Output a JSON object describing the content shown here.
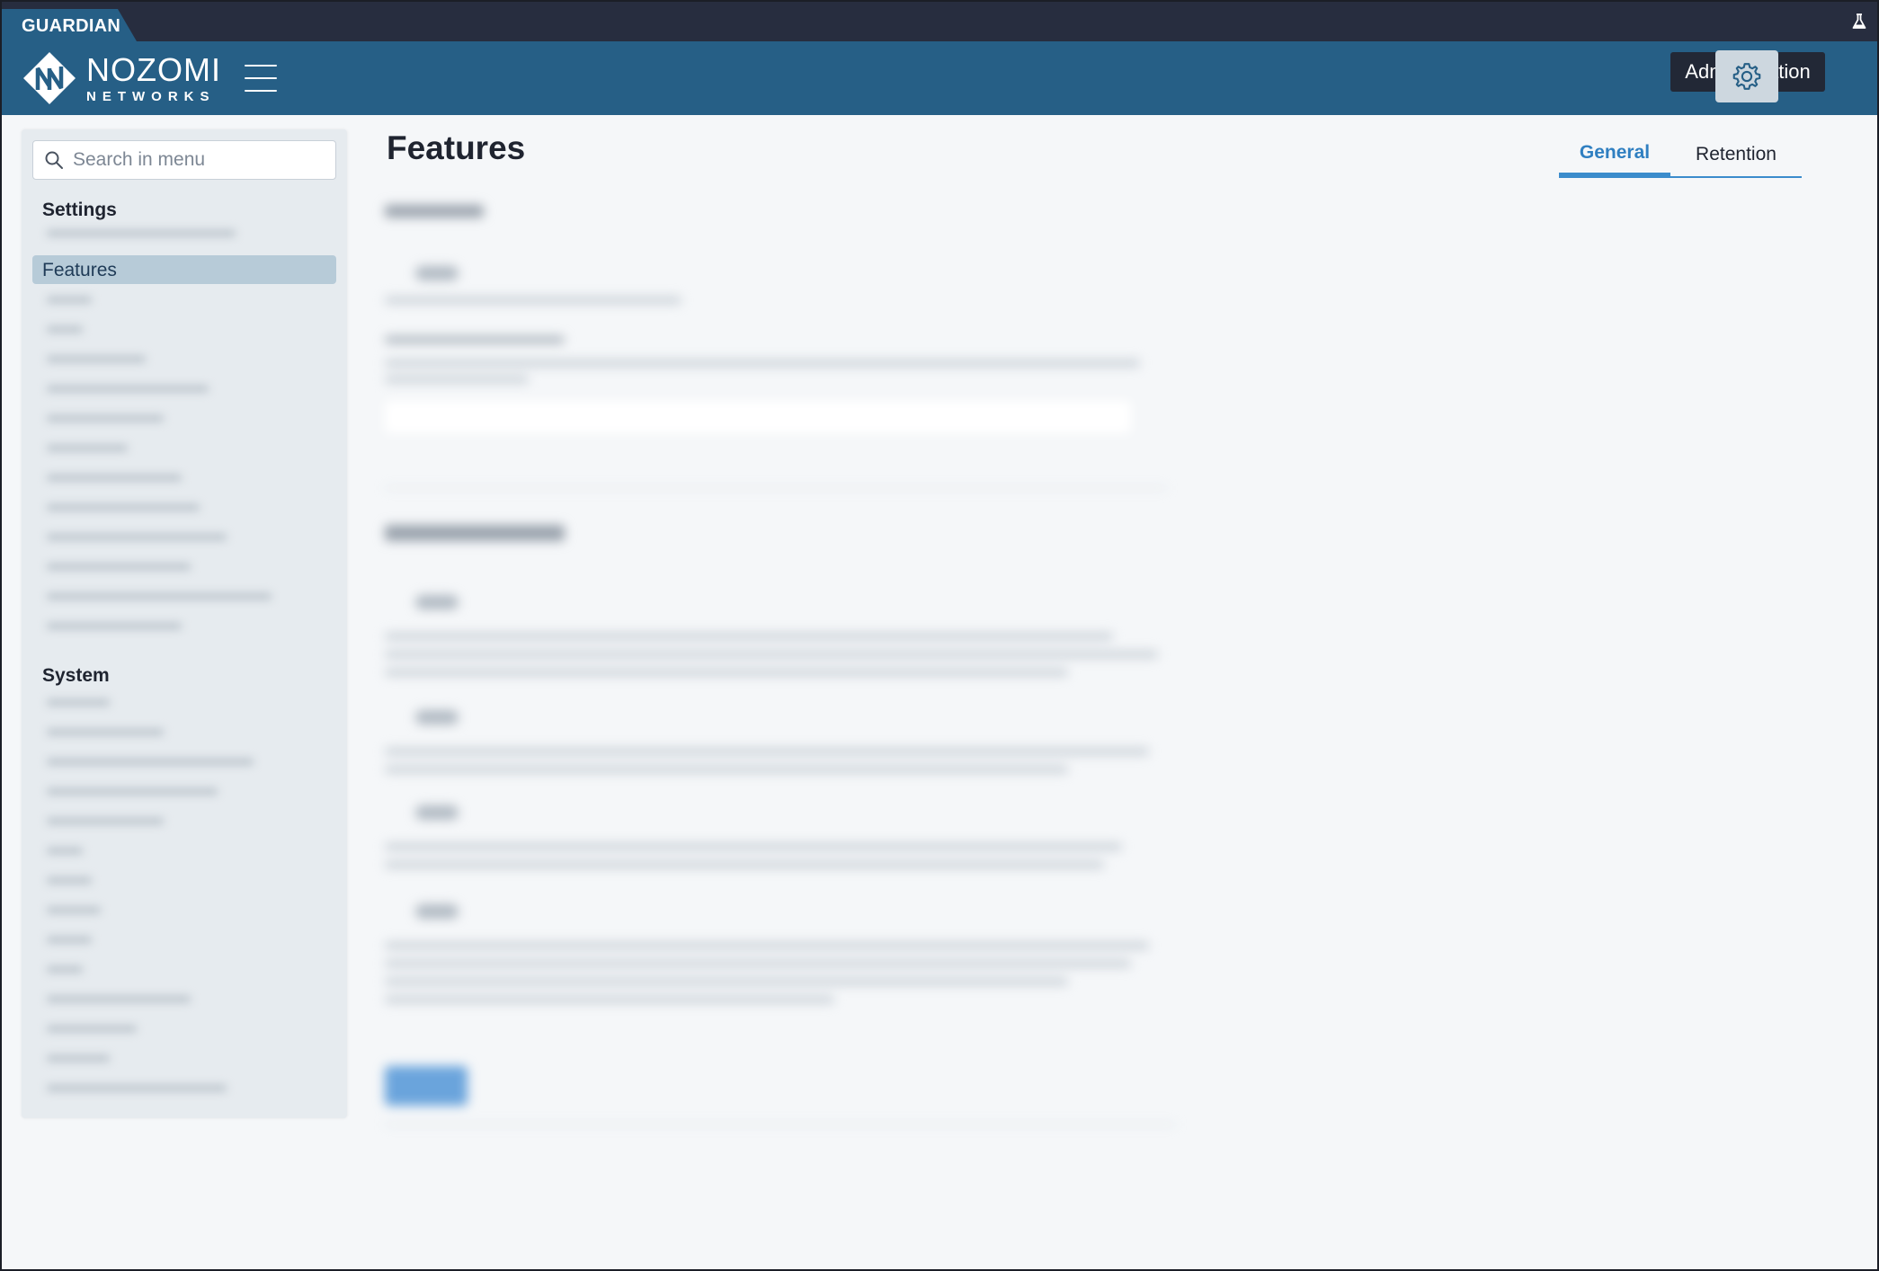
{
  "app": {
    "product_label": "GUARDIAN",
    "logo_top": "NOZOMI",
    "logo_bottom": "NETWORKS"
  },
  "header": {
    "admin_tooltip": "Administration",
    "admin_icon": "gear-icon",
    "menu_icon": "hamburger-icon",
    "lab_icon": "flask-icon"
  },
  "sidebar": {
    "search_placeholder": "Search in menu",
    "settings_heading": "Settings",
    "active_item": "Features",
    "system_heading": "System"
  },
  "main": {
    "title": "Features",
    "tabs": [
      {
        "label": "General",
        "active": true
      },
      {
        "label": "Retention",
        "active": false
      }
    ]
  },
  "colors": {
    "header": "#265f86",
    "topstrip": "#272d3f",
    "accent": "#3b8ccc",
    "sidebar_bg": "#e6ebef",
    "active_item_bg": "#b7cbd8"
  }
}
